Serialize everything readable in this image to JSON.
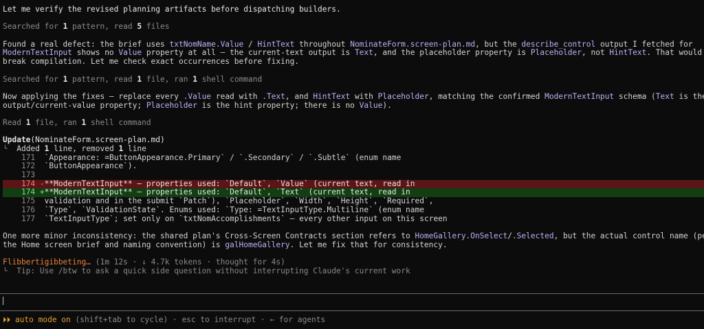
{
  "transcript": {
    "l1": "Let me verify the revised planning artifacts before dispatching builders.",
    "search1": {
      "a": "Searched for ",
      "n1": "1",
      "b": " pattern, read ",
      "n2": "5",
      "c": " files"
    },
    "defect": {
      "l1": [
        {
          "t": "Found a real defect: the brief uses ",
          "c": ""
        },
        {
          "t": "txtNomName.Value",
          "c": "hl"
        },
        {
          "t": " / ",
          "c": ""
        },
        {
          "t": "HintText",
          "c": "hl"
        },
        {
          "t": " throughout ",
          "c": ""
        },
        {
          "t": "NominateForm.screen-plan.md",
          "c": "hl"
        },
        {
          "t": ", but the ",
          "c": ""
        },
        {
          "t": "describe_control",
          "c": "hl"
        },
        {
          "t": " output I fetched for",
          "c": ""
        }
      ],
      "l2": [
        {
          "t": "ModernTextInput",
          "c": "hl"
        },
        {
          "t": " shows no ",
          "c": ""
        },
        {
          "t": "Value",
          "c": "hl"
        },
        {
          "t": " property at all — the current-text output is ",
          "c": ""
        },
        {
          "t": "Text",
          "c": "hl"
        },
        {
          "t": ", and the placeholder property is ",
          "c": ""
        },
        {
          "t": "Placeholder",
          "c": "hl"
        },
        {
          "t": ", not ",
          "c": ""
        },
        {
          "t": "HintText",
          "c": "hl"
        },
        {
          "t": ". That would",
          "c": ""
        }
      ],
      "l3": "break compilation. Let me check exact occurrences before fixing."
    },
    "search2": {
      "a": "Searched for ",
      "n1": "1",
      "b": " pattern, read ",
      "n2": "1",
      "c": " file, ran ",
      "n3": "1",
      "d": " shell command"
    },
    "fix": {
      "l1": [
        {
          "t": "Now applying the fixes — replace every ",
          "c": ""
        },
        {
          "t": ".Value",
          "c": "hl"
        },
        {
          "t": " read with ",
          "c": ""
        },
        {
          "t": ".Text",
          "c": "hl"
        },
        {
          "t": ", and ",
          "c": ""
        },
        {
          "t": "HintText",
          "c": "hl"
        },
        {
          "t": " with ",
          "c": ""
        },
        {
          "t": "Placeholder",
          "c": "hl"
        },
        {
          "t": ", matching the confirmed ",
          "c": ""
        },
        {
          "t": "ModernTextInput",
          "c": "hl"
        },
        {
          "t": " schema (",
          "c": ""
        },
        {
          "t": "Text",
          "c": "hl"
        },
        {
          "t": " is the",
          "c": ""
        }
      ],
      "l2": [
        {
          "t": "output/current-value property; ",
          "c": ""
        },
        {
          "t": "Placeholder",
          "c": "hl"
        },
        {
          "t": " is the hint property; there is no ",
          "c": ""
        },
        {
          "t": "Value",
          "c": "hl"
        },
        {
          "t": ").",
          "c": ""
        }
      ]
    },
    "read1": {
      "a": "Read ",
      "n1": "1",
      "b": " file, ran ",
      "n2": "1",
      "c": " shell command"
    },
    "update": {
      "title": "Update",
      "file": "(NominateForm.screen-plan.md)",
      "summary_corner": "└",
      "summary_a": "  Added ",
      "summary_n1": "1",
      "summary_b": " line, removed ",
      "summary_n2": "1",
      "summary_c": " line"
    },
    "diff": [
      {
        "type": "ctx",
        "no": "171",
        "sign": " ",
        "text": "`Appearance: =ButtonAppearance.Primary` / `.Secondary` / `.Subtle` (enum name"
      },
      {
        "type": "ctx",
        "no": "172",
        "sign": " ",
        "text": "`ButtonAppearance`)."
      },
      {
        "type": "ctx",
        "no": "173",
        "sign": " ",
        "text": ""
      },
      {
        "type": "del",
        "no": "174",
        "sign": "-",
        "text": "**ModernTextInput** — properties used: `Default`, `Value` (current text, read in"
      },
      {
        "type": "add",
        "no": "174",
        "sign": "+",
        "text": "**ModernTextInput** — properties used: `Default`, `Text` (current text, read in"
      },
      {
        "type": "ctx",
        "no": "175",
        "sign": " ",
        "text": "validation and in the submit `Patch`), `Placeholder`, `Width`, `Height`, `Required`,"
      },
      {
        "type": "ctx",
        "no": "176",
        "sign": " ",
        "text": "`Type`, `ValidationState`. Enums used: `Type: =TextInputType.Multiline` (enum name"
      },
      {
        "type": "ctx",
        "no": "177",
        "sign": " ",
        "text": "`TextInputType`; set only on `txtNomAccomplishments` — every other input on this screen"
      }
    ],
    "minor": {
      "l1": [
        {
          "t": "One more minor inconsistency: the shared plan's Cross-Screen Contracts section refers to ",
          "c": ""
        },
        {
          "t": "HomeGallery.OnSelect",
          "c": "hl"
        },
        {
          "t": "/",
          "c": ""
        },
        {
          "t": ".Selected",
          "c": "hl"
        },
        {
          "t": ", but the actual control name (per",
          "c": ""
        }
      ],
      "l2": [
        {
          "t": "the Home screen brief and naming convention) is ",
          "c": ""
        },
        {
          "t": "galHomeGallery",
          "c": "hl"
        },
        {
          "t": ". Let me fix that for consistency.",
          "c": ""
        }
      ]
    },
    "spinner": {
      "word": "Flibbertigibbeting…",
      "a": " (1m 12s · ",
      "arrow": "↓",
      "b": " 4.7k tokens · thought for 4s)"
    },
    "tip": "└  Tip: Use /btw to ask a quick side question without interrupting Claude's current work"
  },
  "status": {
    "arrows": "⏵⏵",
    "mode": " auto mode on",
    "cycle": " (shift+tab to cycle)",
    "sep1": " · ",
    "interrupt": "esc to interrupt",
    "sep2": " · ",
    "agents": "← for agents"
  },
  "colors": {
    "highlight": "#b7b3f5",
    "spinner": "#e8833a",
    "mode": "#e0a030",
    "diff_del": "#5a1616",
    "diff_add": "#133d13"
  }
}
